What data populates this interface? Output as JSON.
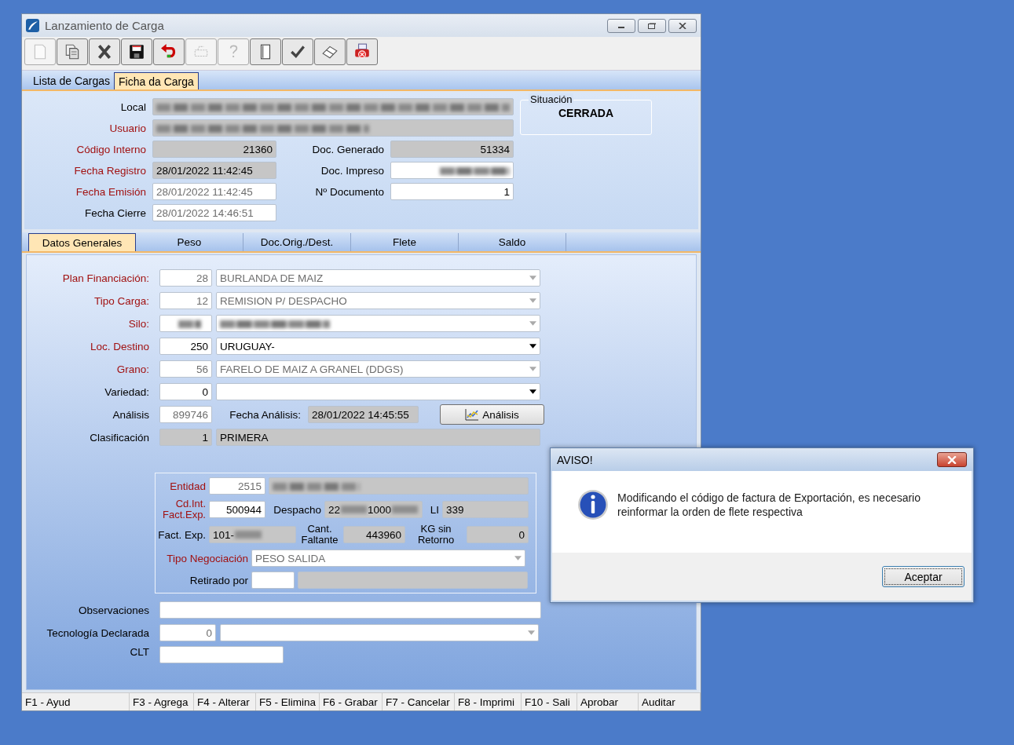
{
  "window": {
    "title": "Lanzamiento de Carga"
  },
  "toolbar": [
    {
      "kind": "new",
      "disabled": true
    },
    {
      "kind": "copy",
      "disabled": false
    },
    {
      "kind": "delete",
      "disabled": false
    },
    {
      "kind": "save",
      "disabled": false
    },
    {
      "kind": "undo",
      "disabled": false
    },
    {
      "kind": "stamp",
      "disabled": true
    },
    {
      "kind": "help",
      "disabled": true
    },
    {
      "kind": "door",
      "disabled": false
    },
    {
      "kind": "check",
      "disabled": false
    },
    {
      "kind": "eraser",
      "disabled": false
    },
    {
      "kind": "print",
      "disabled": false
    }
  ],
  "tabs": [
    {
      "label": "Lista de Cargas",
      "selected": false
    },
    {
      "label": "Ficha da Carga",
      "selected": true
    }
  ],
  "header": {
    "local": {
      "label": "Local",
      "required": false,
      "locked": true,
      "blurred": true
    },
    "usuario": {
      "label": "Usuario",
      "required": true,
      "locked": true,
      "blurred": true
    },
    "codigo_interno": {
      "label": "Código Interno",
      "required": true,
      "value": "21360",
      "locked": true,
      "dimmed": false
    },
    "doc_generado": {
      "label": "Doc. Generado",
      "required": false,
      "value": "51334",
      "locked": true,
      "dimmed": false
    },
    "fecha_registro": {
      "label": "Fecha Registro",
      "required": true,
      "value": "28/01/2022 11:42:45",
      "locked": true,
      "dimmed": false
    },
    "doc_impreso": {
      "label": "Doc. Impreso",
      "required": false,
      "locked": false,
      "blurred": true
    },
    "fecha_emision": {
      "label": "Fecha Emisión",
      "required": true,
      "value": "28/01/2022 11:42:45",
      "locked": false,
      "dimmed": true
    },
    "n_documento": {
      "label": "Nº Documento",
      "required": false,
      "value": "1",
      "locked": false,
      "dimmed": false
    },
    "fecha_cierre": {
      "label": "Fecha Cierre",
      "required": false,
      "value": "28/01/2022 14:46:51",
      "locked": false,
      "dimmed": true
    }
  },
  "situation": {
    "label": "Situación",
    "value": "CERRADA"
  },
  "subtabs": [
    {
      "label": "Datos Generales",
      "selected": true
    },
    {
      "label": "Peso",
      "selected": false
    },
    {
      "label": "Doc.Orig./Dest.",
      "selected": false
    },
    {
      "label": "Flete",
      "selected": false
    },
    {
      "label": "Saldo",
      "selected": false
    }
  ],
  "general": [
    {
      "label": "Plan Financiación:",
      "required": true,
      "code": "28",
      "value": "BURLANDA DE MAIZ",
      "locked": false,
      "dimmed": true
    },
    {
      "label": "Tipo Carga:",
      "required": true,
      "code": "12",
      "value": "REMISION P/ DESPACHO",
      "locked": false,
      "dimmed": true
    },
    {
      "label": "Silo:",
      "required": true,
      "locked": false,
      "dimmed": true,
      "blurred": true
    },
    {
      "label": "Loc. Destino",
      "required": true,
      "code": "250",
      "value": "URUGUAY-",
      "locked": false,
      "dimmed": false
    },
    {
      "label": "Grano:",
      "required": true,
      "code": "56",
      "value": "FARELO DE MAIZ A GRANEL (DDGS)",
      "locked": false,
      "dimmed": true
    },
    {
      "label": "Variedad:",
      "required": false,
      "code": "0",
      "locked": false,
      "dimmed": false
    }
  ],
  "analisis": {
    "label": "Análisis",
    "required": false,
    "code": "899746",
    "locked": false,
    "dimmed": true,
    "date_label": "Fecha Análisis:",
    "date": "28/01/2022 14:45:55",
    "date_locked": true,
    "button": "Análisis"
  },
  "clasificacion": {
    "label": "Clasificación",
    "required": false,
    "code": "1",
    "value": "PRIMERA",
    "locked": true,
    "dimmed": false
  },
  "export_group": {
    "entidad": {
      "label": "Entidad",
      "required": true,
      "code": "2515",
      "locked": false,
      "dimmed": true,
      "name_blurred": true
    },
    "cd_int": {
      "label": "Cd.Int. Fact.Exp.",
      "required": true,
      "value": "500944",
      "locked": false,
      "dimmed": false
    },
    "despacho": {
      "label": "Despacho",
      "required": false,
      "locked": true,
      "dimmed": false,
      "parts": [
        {
          "kind": "text",
          "text": "22"
        },
        {
          "kind": "blur"
        },
        {
          "kind": "text",
          "text": "1000"
        },
        {
          "kind": "blur"
        }
      ]
    },
    "li": {
      "label": "LI",
      "required": false,
      "value": "339",
      "locked": true,
      "dimmed": false
    },
    "fact_exp": {
      "label": "Fact. Exp.",
      "required": false,
      "locked": true,
      "dimmed": false,
      "parts": [
        {
          "kind": "text",
          "text": "101-"
        },
        {
          "kind": "blur"
        }
      ]
    },
    "cant_faltante": {
      "label": "Cant. Faltante",
      "required": false,
      "value": "443960",
      "locked": true,
      "dimmed": false
    },
    "kg_sin_retorno": {
      "label": "KG sin Retorno",
      "required": false,
      "value": "0",
      "locked": true,
      "dimmed": false
    },
    "tipo_negociacion": {
      "label": "Tipo Negociación",
      "required": true,
      "value": "PESO SALIDA",
      "locked": false,
      "dimmed": true
    },
    "retirado_por": {
      "label": "Retirado por",
      "required": false,
      "locked": false
    }
  },
  "observaciones": {
    "label": "Observaciones",
    "required": false,
    "locked": false
  },
  "tecnologia": {
    "label": "Tecnología Declarada",
    "required": false,
    "code": "0",
    "locked": false,
    "dimmed": true
  },
  "clt": {
    "label": "CLT",
    "required": false,
    "locked": false
  },
  "status_bar": [
    "F1 - Ayud",
    "F3 - Agrega",
    "F4 - Alterar",
    "F5 - Elimina",
    "F6 - Grabar",
    "F7 - Cancelar",
    "F8 - Imprimi",
    "F10 - Sali",
    "Aprobar",
    "Auditar"
  ],
  "dialog": {
    "title": "AVISO!",
    "message": "Modificando el código de factura de Exportación, es necesario reinformar la orden de flete respectiva",
    "button": "Aceptar"
  }
}
